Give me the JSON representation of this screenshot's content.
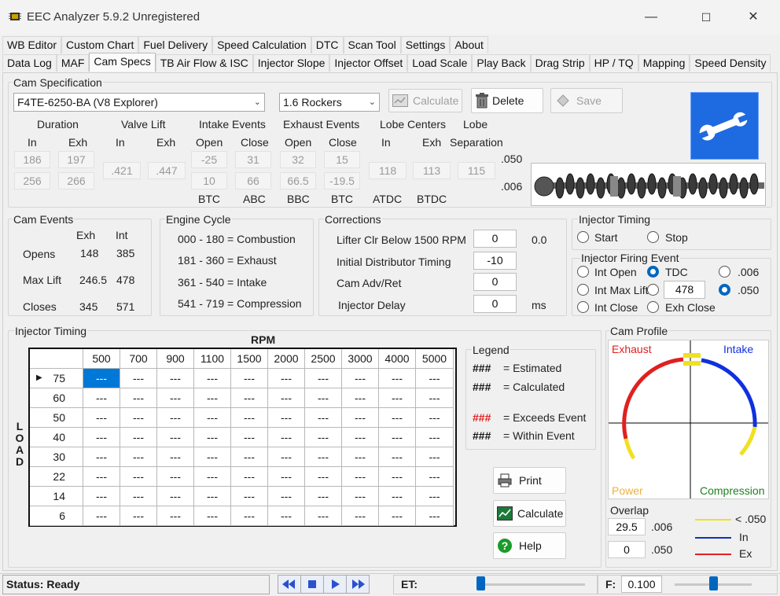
{
  "window": {
    "title": "EEC Analyzer 5.9.2 Unregistered",
    "min": "—",
    "max": "☐",
    "close": "✕"
  },
  "tabs_row1": [
    "WB Editor",
    "Custom Chart",
    "Fuel Delivery",
    "Speed Calculation",
    "DTC",
    "Scan Tool",
    "Settings",
    "About"
  ],
  "tabs_row2": [
    "Data Log",
    "MAF",
    "Cam Specs",
    "TB Air Flow & ISC",
    "Injector Slope",
    "Injector Offset",
    "Load Scale",
    "Play Back",
    "Drag Strip",
    "HP / TQ",
    "Mapping",
    "Speed Density"
  ],
  "active_tab": "Cam Specs",
  "cam_spec": {
    "group_label": "Cam Specification",
    "cam_select": "F4TE-6250-BA (V8 Explorer)",
    "rocker_select": "1.6 Rockers",
    "calculate_label": "Calculate",
    "delete_label": "Delete",
    "save_label": "Save",
    "hdr": {
      "duration": "Duration",
      "valve_lift": "Valve Lift",
      "intake_events": "Intake Events",
      "exhaust_events": "Exhaust Events",
      "lobe_centers": "Lobe Centers",
      "lobe": "Lobe",
      "separation": "Separation"
    },
    "sub": {
      "dur_in": "In",
      "dur_exh": "Exh",
      "lift_in": "In",
      "lift_exh": "Exh",
      "int_open": "Open",
      "int_close": "Close",
      "exh_open": "Open",
      "exh_close": "Close",
      "lc_in": "In",
      "lc_exh": "Exh"
    },
    "row050": {
      "dur_in": "186",
      "dur_exh": "197",
      "int_open": "-25",
      "int_close": "31",
      "exh_open": "32",
      "exh_close": "15"
    },
    "row006": {
      "dur_in": "256",
      "dur_exh": "266",
      "int_open": "10",
      "int_close": "66",
      "exh_open": "66.5",
      "exh_close": "-19.5"
    },
    "lift_in": ".421",
    "lift_exh": ".447",
    "lc_in": "118",
    "lc_exh": "113",
    "lobe_sep": "115",
    "tag050": ".050",
    "tag006": ".006",
    "units": {
      "int_open": "BTC",
      "int_close": "ABC",
      "exh_open": "BBC",
      "exh_close": "BTC",
      "lc_in": "ATDC",
      "lc_exh": "BTDC"
    }
  },
  "cam_events": {
    "label": "Cam Events",
    "col_exh": "Exh",
    "col_int": "Int",
    "rows": [
      {
        "name": "Opens",
        "exh": "148",
        "int": "385"
      },
      {
        "name": "Max Lift",
        "exh": "246.5",
        "int": "478"
      },
      {
        "name": "Closes",
        "exh": "345",
        "int": "571"
      }
    ]
  },
  "engine_cycle": {
    "label": "Engine Cycle",
    "rows": [
      "000 - 180 = Combustion",
      "181 - 360 = Exhaust",
      "361 - 540 = Intake",
      "541 - 719 = Compression"
    ]
  },
  "corrections": {
    "label": "Corrections",
    "rows": [
      {
        "name": "Lifter Clr Below 1500 RPM",
        "value": "0",
        "extra": "0.0"
      },
      {
        "name": "Initial Distributor Timing",
        "value": "-10",
        "extra": ""
      },
      {
        "name": "Cam Adv/Ret",
        "value": "0",
        "extra": ""
      },
      {
        "name": "Injector Delay",
        "value": "0",
        "extra": "ms"
      }
    ]
  },
  "inj_timing_opt": {
    "label": "Injector  Timing",
    "start": "Start",
    "stop": "Stop"
  },
  "inj_firing": {
    "label": "Injector Firing Event",
    "int_open": "Int Open",
    "tdc": "TDC",
    "v006": ".006",
    "int_max_lift": "Int Max Lift",
    "max_lift_value": "478",
    "v050": ".050",
    "int_close": "Int Close",
    "exh_close": "Exh Close",
    "selected_event": "TDC",
    "selected_lift": ".050"
  },
  "inj_table": {
    "label": "Injector Timing",
    "rpm_label": "RPM",
    "load_label": [
      "L",
      "O",
      "A",
      "D"
    ],
    "rpms": [
      "500",
      "700",
      "900",
      "1100",
      "1500",
      "2000",
      "2500",
      "3000",
      "4000",
      "5000"
    ],
    "loads": [
      "75",
      "60",
      "50",
      "40",
      "30",
      "22",
      "14",
      "6"
    ],
    "cell": "---",
    "row_marker": "▶"
  },
  "legend": {
    "label": "Legend",
    "items": [
      {
        "mark": "###",
        "text": "= Estimated",
        "color": "#111111"
      },
      {
        "mark": "###",
        "text": "= Calculated",
        "color": "#111111"
      },
      {
        "mark": "###",
        "text": "= Exceeds Event",
        "color": "#e02020"
      },
      {
        "mark": "###",
        "text": "=  Within Event",
        "color": "#111111"
      }
    ]
  },
  "actions": {
    "print": "Print",
    "calculate": "Calculate",
    "help": "Help"
  },
  "cam_profile": {
    "label": "Cam Profile",
    "exhaust": "Exhaust",
    "intake": "Intake",
    "power": "Power",
    "compression": "Compression",
    "colors": {
      "exhaust": "#e02020",
      "intake": "#1030e0",
      "lift050": "#f0e020",
      "power": "#f0b040",
      "compression": "#208020"
    }
  },
  "overlap": {
    "label": "Overlap",
    "v006": "29.5",
    "t006": ".006",
    "v050": "0",
    "t050": ".050",
    "key": [
      {
        "label": "< .050",
        "color": "#f0e020"
      },
      {
        "label": "In",
        "color": "#1030c0"
      },
      {
        "label": "Ex",
        "color": "#e02020"
      }
    ]
  },
  "status": {
    "text": "Status: Ready",
    "et_label": "ET:",
    "f_label": "F:",
    "f_value": "0.100"
  }
}
